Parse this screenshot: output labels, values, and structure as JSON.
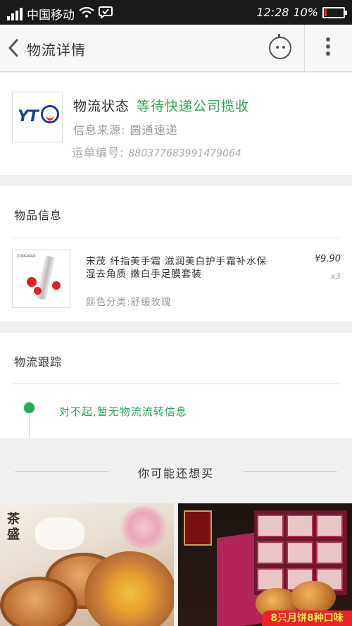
{
  "status_bar": {
    "carrier": "中国移动",
    "time": "12:28",
    "battery": "10%",
    "battery_level": 0.1
  },
  "nav": {
    "title": "物流详情",
    "back_icon": "chevron-left-icon",
    "robot_icon": "robot-face-icon",
    "more_icon": "more-vertical-icon"
  },
  "logistics": {
    "status_label": "物流状态",
    "status_value": "等待快递公司揽收",
    "source": "信息来源: 圆通速递",
    "waybill_label": "运单编号:",
    "waybill_number": "880377683991479064",
    "carrier_logo_text": "YT"
  },
  "goods": {
    "section_title": "物品信息",
    "name": "宋茂 纤指美手霜 滋润美白护手霜补水保湿去角质 嫩白手足膜套装",
    "price": "¥9.90",
    "quantity": "x3",
    "spec": "颜色分类:舒缓玫瑰"
  },
  "tracking": {
    "section_title": "物流跟踪",
    "message": "对不起,暂无物流流转信息"
  },
  "recommend": {
    "title": "你可能还想买",
    "products": [
      {
        "label": "茶盛"
      },
      {
        "banner": "8只月饼8种口味"
      }
    ]
  },
  "colors": {
    "accent_green": "#2aa75a",
    "logo_blue": "#1e3f8f"
  }
}
